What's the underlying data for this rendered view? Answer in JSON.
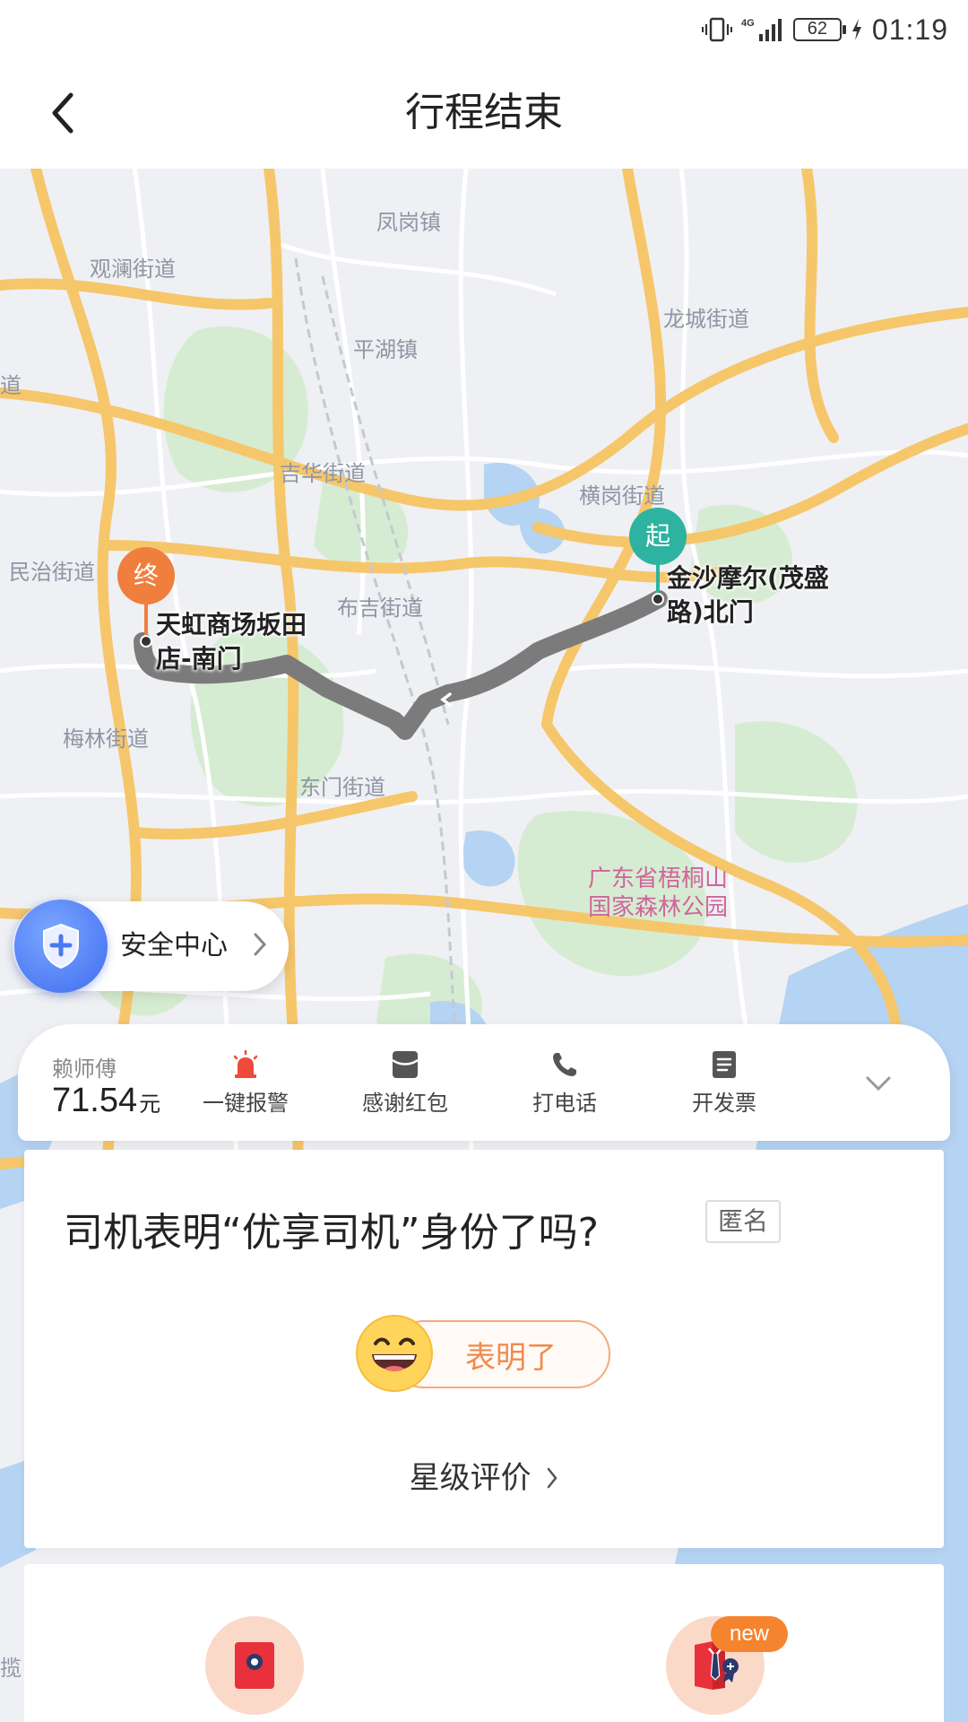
{
  "status_bar": {
    "network": "4G",
    "battery": "62",
    "time": "01:19"
  },
  "header": {
    "title": "行程结束"
  },
  "map": {
    "district_labels": [
      "凤岗镇",
      "观澜街道",
      "龙城街道",
      "平湖镇",
      "吉华街道",
      "民治街道",
      "布吉街道",
      "横岗街道",
      "梅林街道",
      "东门街道",
      "道",
      "揽"
    ],
    "park_label_line1": "广东省梧桐山",
    "park_label_line2": "国家森林公园",
    "start_pin": "起",
    "end_pin": "终",
    "start_name_line1": "金沙摩尔(茂盛",
    "start_name_line2": "路)北门",
    "end_name_line1": "天虹商场坂田",
    "end_name_line2": "店-南门",
    "colors": {
      "route": "#7b7b7b",
      "start": "#2eb3a0",
      "end": "#f07e3d",
      "road": "#f6c66a"
    }
  },
  "safety": {
    "label": "安全中心"
  },
  "driver": {
    "name": "赖师傅",
    "fare": "71.54",
    "fare_unit": "元",
    "actions": [
      {
        "icon": "alarm-icon",
        "label": "一键报警"
      },
      {
        "icon": "red-envelope-icon",
        "label": "感谢红包"
      },
      {
        "icon": "phone-icon",
        "label": "打电话"
      },
      {
        "icon": "invoice-icon",
        "label": "开发票"
      }
    ]
  },
  "question": {
    "title": "司机表明“优享司机”身份了吗?",
    "anon": "匿名",
    "confirm": "表明了",
    "rating": "星级评价"
  },
  "bottom": {
    "new_badge": "new"
  }
}
